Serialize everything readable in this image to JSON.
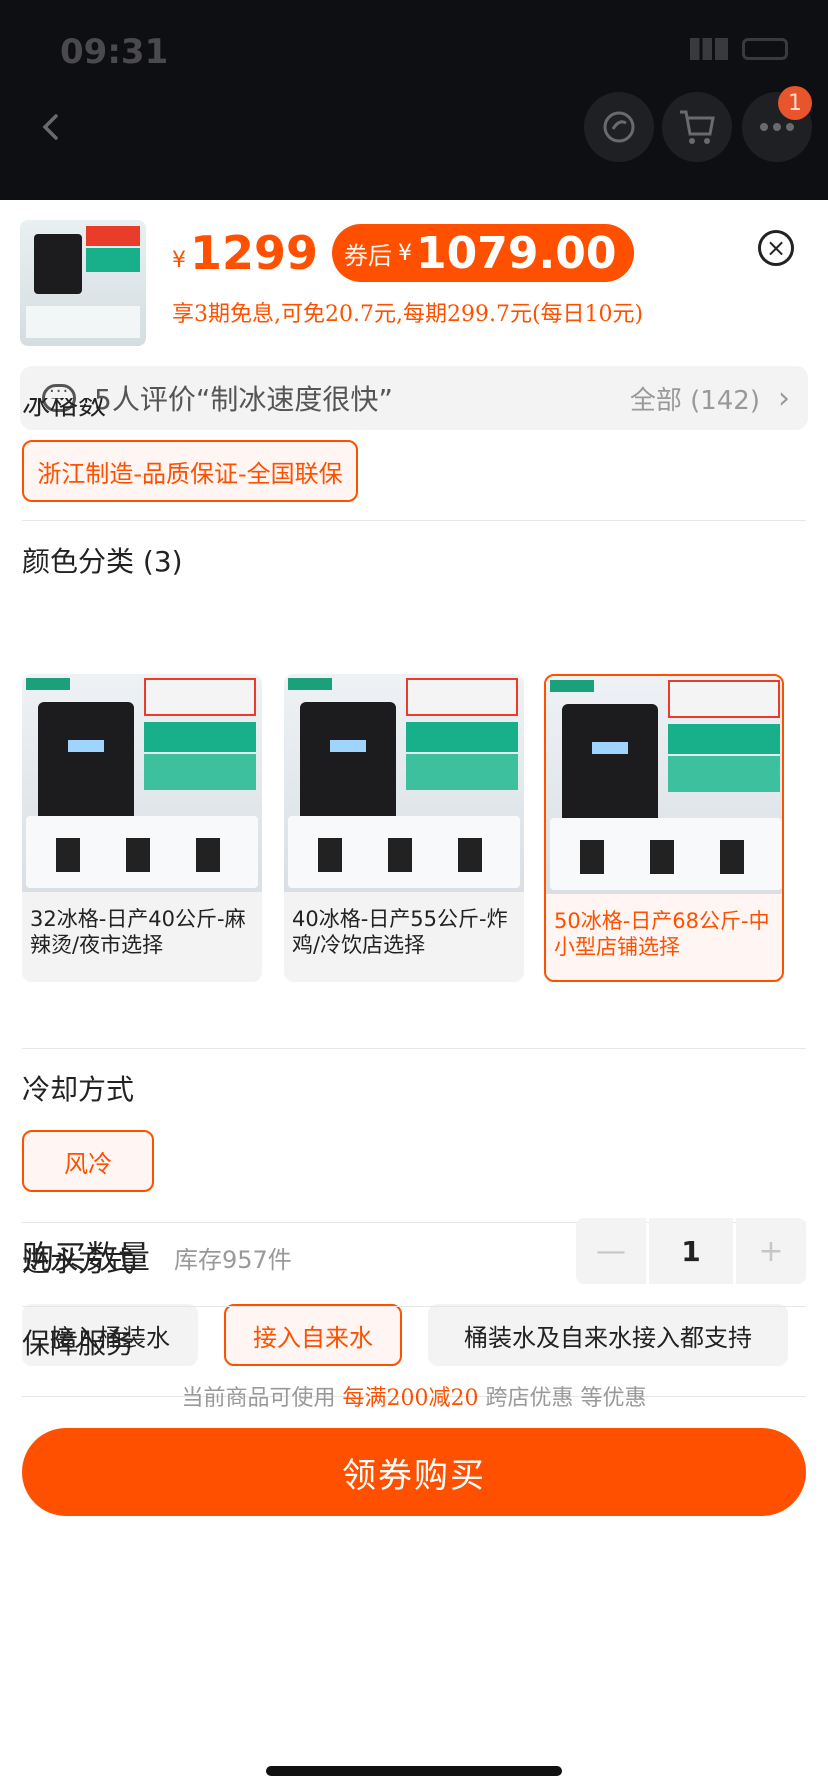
{
  "status": {
    "time": "09:31"
  },
  "nav": {
    "cart_badge": "1"
  },
  "product": {
    "price_symbol": "¥",
    "price": "1299",
    "coupon_label": "券后",
    "coupon_symbol": "¥",
    "coupon_price": "1079.00",
    "installment": "享3期免息,可免20.7元,每期299.7元(每日10元)"
  },
  "review": {
    "text": "5人评价“制冰速度很快”",
    "all_label": "全部 (142)"
  },
  "sections": {
    "ice_grid_label": "冰格数",
    "origin_option": "浙江制造-品质保证-全国联保",
    "color_label": "颜色分类 (3)",
    "cooling_label": "冷却方式",
    "water_label": "进水方式",
    "service_label": "保障服务"
  },
  "colors": [
    {
      "caption": "32冰格-日产40公斤-麻辣烫/夜市选择",
      "selected": false
    },
    {
      "caption": "40冰格-日产55公斤-炸鸡/冷饮店选择",
      "selected": false
    },
    {
      "caption": "50冰格-日产68公斤-中小型店铺选择",
      "selected": true
    }
  ],
  "cooling": [
    {
      "label": "风冷",
      "selected": true
    }
  ],
  "water": [
    {
      "label": "接入桶装水",
      "selected": false
    },
    {
      "label": "接入自来水",
      "selected": true
    },
    {
      "label": "桶装水及自来水接入都支持",
      "selected": false
    }
  ],
  "quantity": {
    "label": "购买数量",
    "stock": "库存957件",
    "value": "1",
    "minus": "—",
    "plus": "+"
  },
  "promo": {
    "prefix": "当前商品可使用",
    "highlight": "每满200减20",
    "suffix": "跨店优惠 等优惠"
  },
  "buy_button": "领券购买",
  "accent_color": "#ff5000"
}
